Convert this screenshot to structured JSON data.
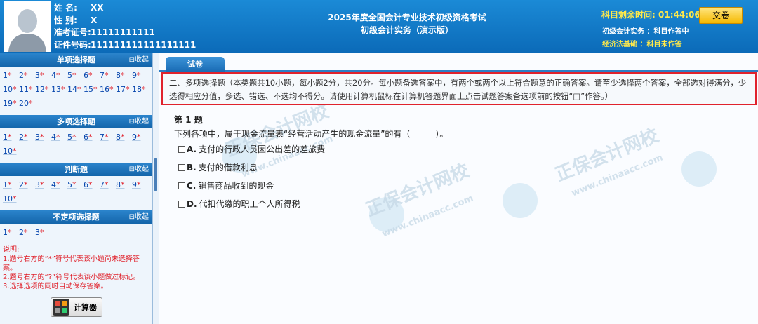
{
  "candidate": {
    "name_label": "姓    名:",
    "name": "XX",
    "gender_label": "性    别:",
    "gender": "X",
    "ticket_label": "准考证号:",
    "ticket": "11111111111",
    "id_label": "证件号码:",
    "id": "111111111111111111"
  },
  "exam": {
    "title": "2025年度全国会计专业技术初级资格考试",
    "subtitle": "初级会计实务（演示版）"
  },
  "timer": {
    "label": "科目剩余时间:",
    "value": "01:44:06"
  },
  "submit_label": "交卷",
  "subjects": [
    {
      "name": "初级会计实务",
      "status": "：科目作答中"
    },
    {
      "name": "经济法基础",
      "status": "：科目未作答"
    }
  ],
  "collapse_label": "⊟收起",
  "sections": [
    {
      "title": "单项选择题",
      "questions": [
        "1",
        "2",
        "3",
        "4",
        "5",
        "6",
        "7",
        "8",
        "9",
        "10",
        "11",
        "12",
        "13",
        "14",
        "15",
        "16",
        "17",
        "18",
        "19",
        "20"
      ]
    },
    {
      "title": "多项选择题",
      "questions": [
        "1",
        "2",
        "3",
        "4",
        "5",
        "6",
        "7",
        "8",
        "9",
        "10"
      ]
    },
    {
      "title": "判断题",
      "questions": [
        "1",
        "2",
        "3",
        "4",
        "5",
        "6",
        "7",
        "8",
        "9",
        "10"
      ]
    },
    {
      "title": "不定项选择题",
      "questions": [
        "1",
        "2",
        "3"
      ]
    }
  ],
  "unanswered_mark": "*",
  "notes": [
    "说明:",
    "1.题号右方的“*”符号代表该小题尚未选择答案。",
    "2.题号右方的“?”符号代表该小题做过标记。",
    "3.选择选项的同时自动保存答案。"
  ],
  "calculator_label": "计算器",
  "tab_label": "试卷",
  "instructions": "二、多项选择题（本类题共10小题，每小题2分，共20分。每小题备选答案中，有两个或两个以上符合题意的正确答案。请至少选择两个答案，全部选对得满分，少选得相应分值，多选、错选、不选均不得分。请使用计算机鼠标在计算机答题界面上点击试题答案备选项前的按钮“□”作答。）",
  "question": {
    "number": "第 1 题",
    "text": "下列各项中，属于现金流量表“经营活动产生的现金流量”的有（　　　）。",
    "options": [
      {
        "key": "A.",
        "text": "支付的行政人员因公出差的差旅费"
      },
      {
        "key": "B.",
        "text": "支付的借款利息"
      },
      {
        "key": "C.",
        "text": "销售商品收到的现金"
      },
      {
        "key": "D.",
        "text": "代扣代缴的职工个人所得税"
      }
    ]
  },
  "watermark": {
    "text_cn": "正保会计网校",
    "text_url": "www.chinaacc.com"
  },
  "colors": {
    "header_blue": "#0b6ab8",
    "timer_yellow": "#ffe94a",
    "submit_gold": "#f5b800",
    "note_red": "#e0222c",
    "instruction_border_red": "#e0222c",
    "link_blue": "#0645ad"
  }
}
